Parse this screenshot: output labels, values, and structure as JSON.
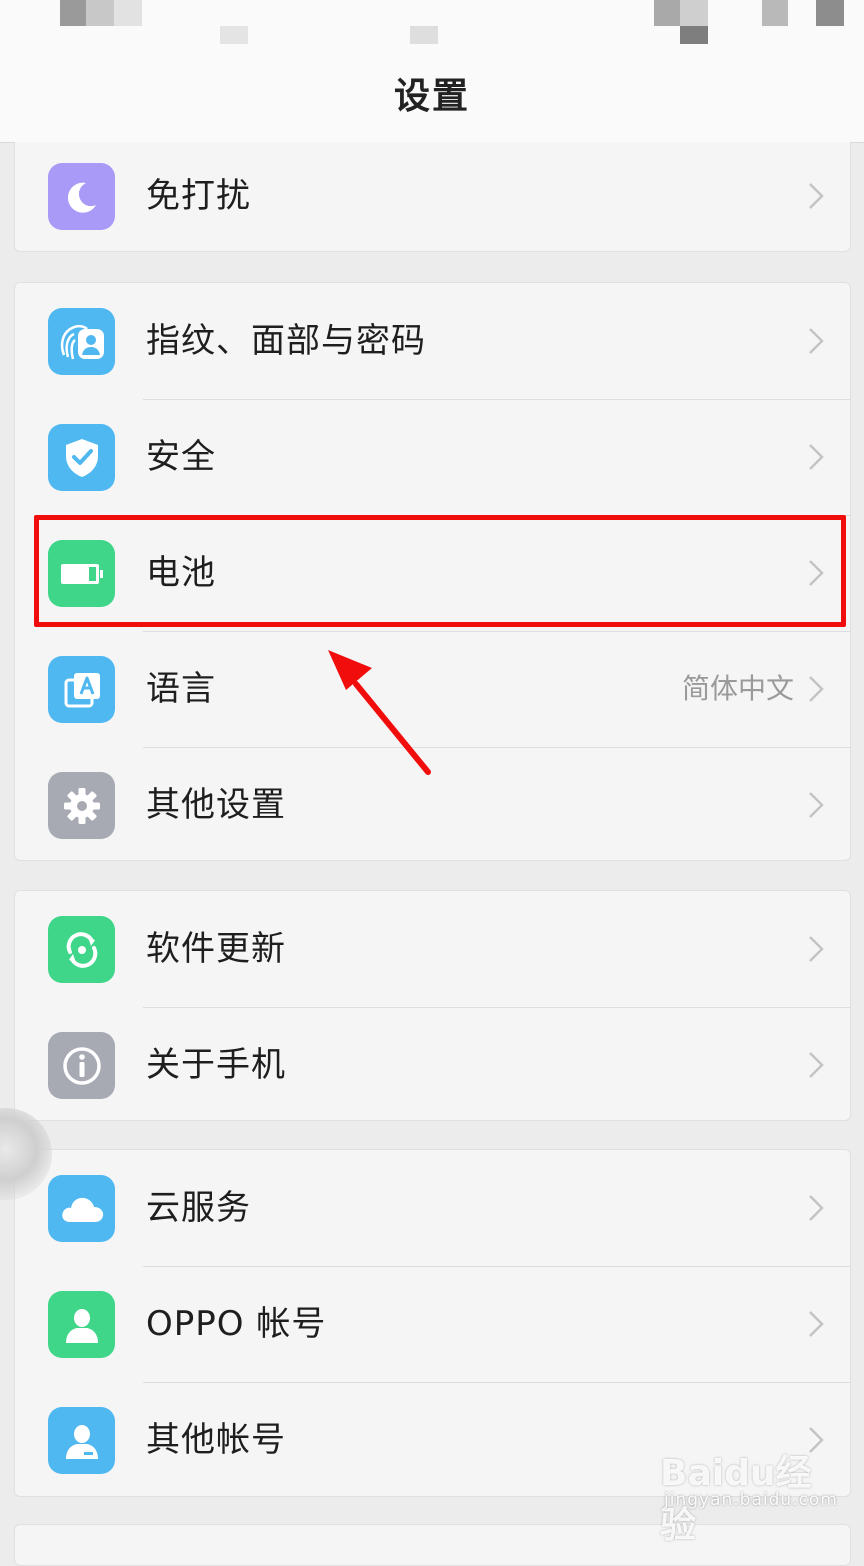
{
  "page": {
    "title": "设置"
  },
  "groups": [
    {
      "items": [
        {
          "name": "do-not-disturb",
          "label": "免打扰",
          "icon": "moon-icon",
          "color": "#a99af7"
        }
      ]
    },
    {
      "items": [
        {
          "name": "fingerprint-face-password",
          "label": "指纹、面部与密码",
          "icon": "fingerprint-face-icon",
          "color": "#4fb8f0"
        },
        {
          "name": "security",
          "label": "安全",
          "icon": "shield-check-icon",
          "color": "#4fb8f0"
        },
        {
          "name": "battery",
          "label": "电池",
          "icon": "battery-icon",
          "color": "#3fd68a"
        },
        {
          "name": "language",
          "label": "语言",
          "value": "简体中文",
          "icon": "language-icon",
          "color": "#4fb8f0"
        },
        {
          "name": "other-settings",
          "label": "其他设置",
          "icon": "gear-icon",
          "color": "#a7aab3"
        }
      ]
    },
    {
      "items": [
        {
          "name": "software-update",
          "label": "软件更新",
          "icon": "update-icon",
          "color": "#3fd68a"
        },
        {
          "name": "about-phone",
          "label": "关于手机",
          "icon": "info-icon",
          "color": "#a7aab3"
        }
      ]
    },
    {
      "items": [
        {
          "name": "cloud-service",
          "label": "云服务",
          "icon": "cloud-icon",
          "color": "#4fb8f0"
        },
        {
          "name": "oppo-account",
          "label": "OPPO 帐号",
          "icon": "user-icon",
          "color": "#3fd68a"
        },
        {
          "name": "other-accounts",
          "label": "其他帐号",
          "icon": "user-icon",
          "color": "#4fb8f0"
        }
      ]
    }
  ],
  "annotation": {
    "highlight_color": "#f20d0d"
  },
  "watermark": {
    "main": "Baidu经验",
    "sub": "jingyan.baidu.com"
  }
}
